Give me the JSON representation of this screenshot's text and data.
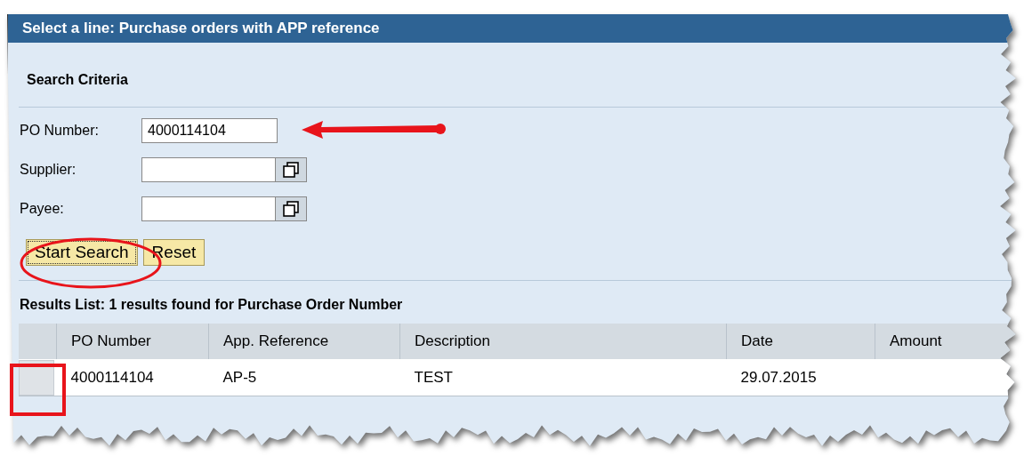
{
  "dialog": {
    "title": "Select a line: Purchase orders with APP reference"
  },
  "search_criteria": {
    "heading": "Search Criteria",
    "fields": [
      {
        "label": "PO Number:",
        "value": "4000114104",
        "kind": "text"
      },
      {
        "label": "Supplier:",
        "kind": "lookup"
      },
      {
        "label": "Payee:",
        "kind": "lookup"
      }
    ],
    "buttons": [
      {
        "label": "Start Search",
        "focused": true
      },
      {
        "label": "Reset",
        "focused": false
      }
    ]
  },
  "results": {
    "title": "Results List: 1 results found for Purchase Order Number",
    "columns": [
      "PO Number",
      "App. Reference",
      "Description",
      "Date",
      "Amount"
    ],
    "rows": [
      {
        "selected": false,
        "cells": [
          "4000114104",
          "AP-5",
          "TEST",
          "29.07.2015"
        ]
      }
    ]
  }
}
